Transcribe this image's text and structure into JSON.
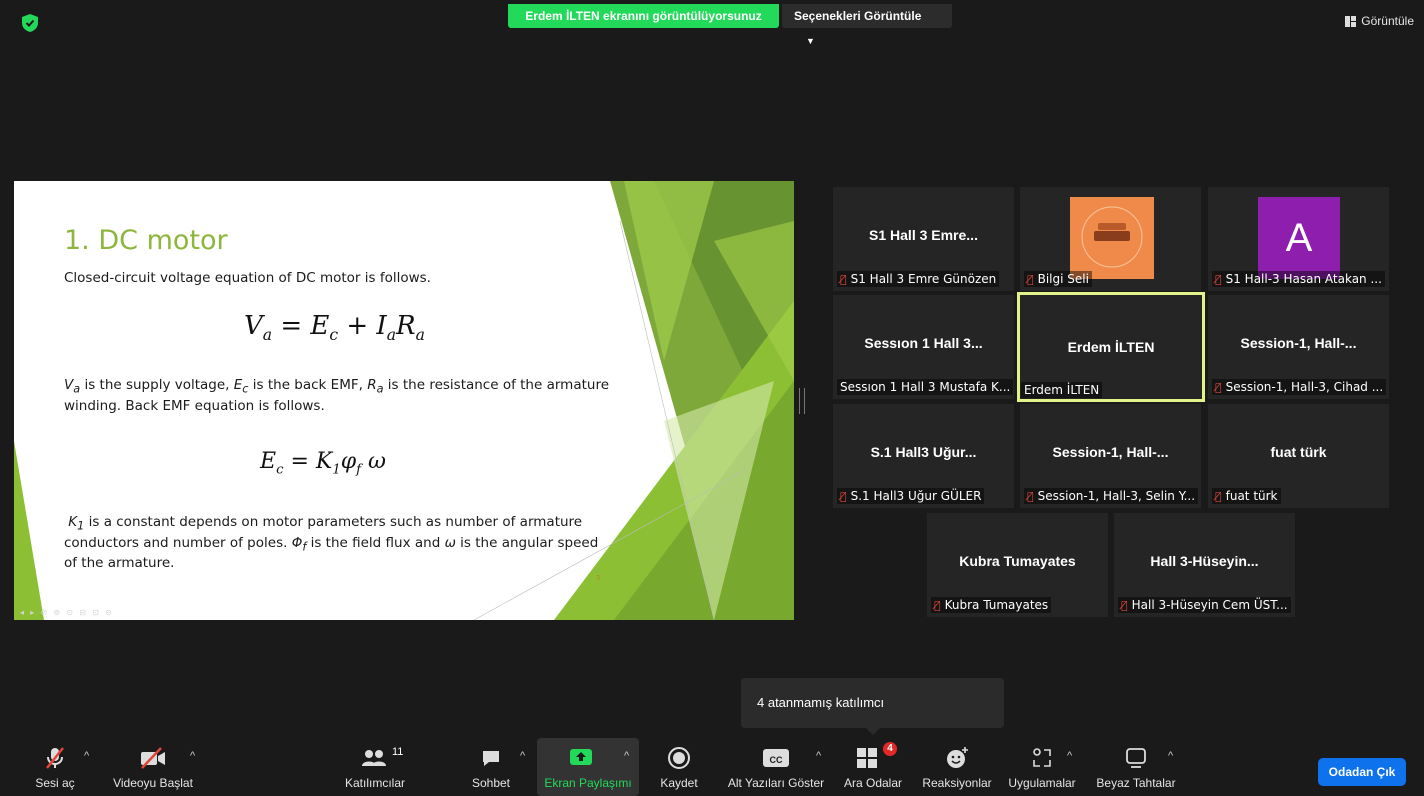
{
  "top": {
    "share_banner": "Erdem İLTEN ekranını görüntülüyorsunuz",
    "view_options": "Seçenekleri Görüntüle",
    "view_button": "Görüntüle"
  },
  "slide": {
    "title": "1. DC motor",
    "line1": "Closed-circuit voltage equation of DC motor is follows.",
    "para2_line1_a": " is the supply voltage, ",
    "para2_line1_b": " is the back EMF, ",
    "para2_line1_c": " is the resistance of the armature",
    "para2_line2": "winding. Back EMF equation is follows.",
    "para3_line1": " is a constant depends on motor parameters such as number of armature",
    "para3_line2_a": "conductors and number of poles. ",
    "para3_line2_b": " is the field flux and ",
    "para3_line2_c": " is the angular speed",
    "para3_line3": "of the armature.",
    "page_number": "3"
  },
  "gallery": {
    "tiles": [
      {
        "name": "S1 Hall 3 Emre...",
        "label": "S1 Hall 3 Emre Günözen",
        "muted": true
      },
      {
        "name": "",
        "label": "Bilgi Seli",
        "muted": true,
        "avatar": "image"
      },
      {
        "name": "",
        "label": "S1 Hall-3 Hasan Atakan ...",
        "muted": true,
        "avatar_letter": "A"
      },
      {
        "name": "Sessıon 1 Hall 3...",
        "label": "Sessıon 1 Hall 3 Mustafa K...",
        "muted": false
      },
      {
        "name": "Erdem İLTEN",
        "label": "Erdem İLTEN",
        "muted": false,
        "active": true
      },
      {
        "name": "Session-1,  Hall-...",
        "label": "Session-1, Hall-3, Cihad ...",
        "muted": true
      },
      {
        "name": "S.1 Hall3 Uğur...",
        "label": "S.1 Hall3 Uğur GÜLER",
        "muted": true
      },
      {
        "name": "Session-1,  Hall-...",
        "label": "Session-1, Hall-3, Selin Y...",
        "muted": true
      },
      {
        "name": "fuat türk",
        "label": "fuat türk",
        "muted": true
      },
      {
        "name": "Kubra Tumayates",
        "label": "Kubra Tumayates",
        "muted": true
      },
      {
        "name": "Hall  3-Hüseyin...",
        "label": "Hall 3-Hüseyin Cem ÜST...",
        "muted": true
      }
    ]
  },
  "tooltip": "4 atanmamış katılımcı",
  "toolbar": {
    "unmute": "Sesi aç",
    "start_video": "Videoyu Başlat",
    "participants": "Katılımcılar",
    "participants_count": "11",
    "chat": "Sohbet",
    "share_screen": "Ekran Paylaşımı",
    "record": "Kaydet",
    "captions": "Alt Yazıları Göster",
    "captions_icon_text": "CC",
    "breakout": "Ara Odalar",
    "breakout_badge": "4",
    "reactions": "Reaksiyonlar",
    "apps": "Uygulamalar",
    "whiteboards": "Beyaz Tahtalar",
    "leave": "Odadan Çık"
  },
  "colors": {
    "share_green": "#23d959",
    "leave_blue": "#0e72ed",
    "slide_title": "#8cb63c",
    "active_border": "#e4f28a",
    "mute_red": "#e0453a"
  }
}
